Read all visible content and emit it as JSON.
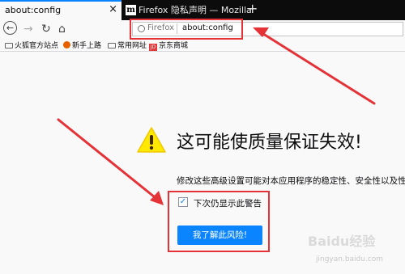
{
  "tabs": [
    {
      "title": "about:config",
      "active": true
    },
    {
      "title": "Firefox 隐私声明 — Mozilla",
      "active": false,
      "icon_letter": "m"
    }
  ],
  "new_tab_label": "+",
  "nav": {
    "back": "←",
    "forward": "→",
    "reload": "↻",
    "home": "⌂"
  },
  "urlbar": {
    "identity_label": "Firefox",
    "url": "about:config"
  },
  "bookmarks": [
    {
      "label": "火狐官方站点",
      "icon": "folder-icon"
    },
    {
      "label": "新手上路",
      "icon": "firefox-icon"
    },
    {
      "label": "常用网址",
      "icon": "folder-icon"
    },
    {
      "label": "京东商城",
      "icon": "jd-icon"
    }
  ],
  "jd_icon_text": "JD",
  "warning": {
    "title": "这可能使质量保证失效!",
    "description": "修改这些高级设置可能对本应用程序的稳定性、安全性以及性能造",
    "checkbox_label": "下次仍显示此警告",
    "checkbox_checked": true,
    "accept_button": "我了解此风险!"
  },
  "colors": {
    "accent": "#0a84ff",
    "annotation_red": "#e53237",
    "warning_yellow": "#ffe900"
  },
  "watermark": {
    "text": "Baidu经验",
    "url": "jingyan.baidu.com"
  }
}
